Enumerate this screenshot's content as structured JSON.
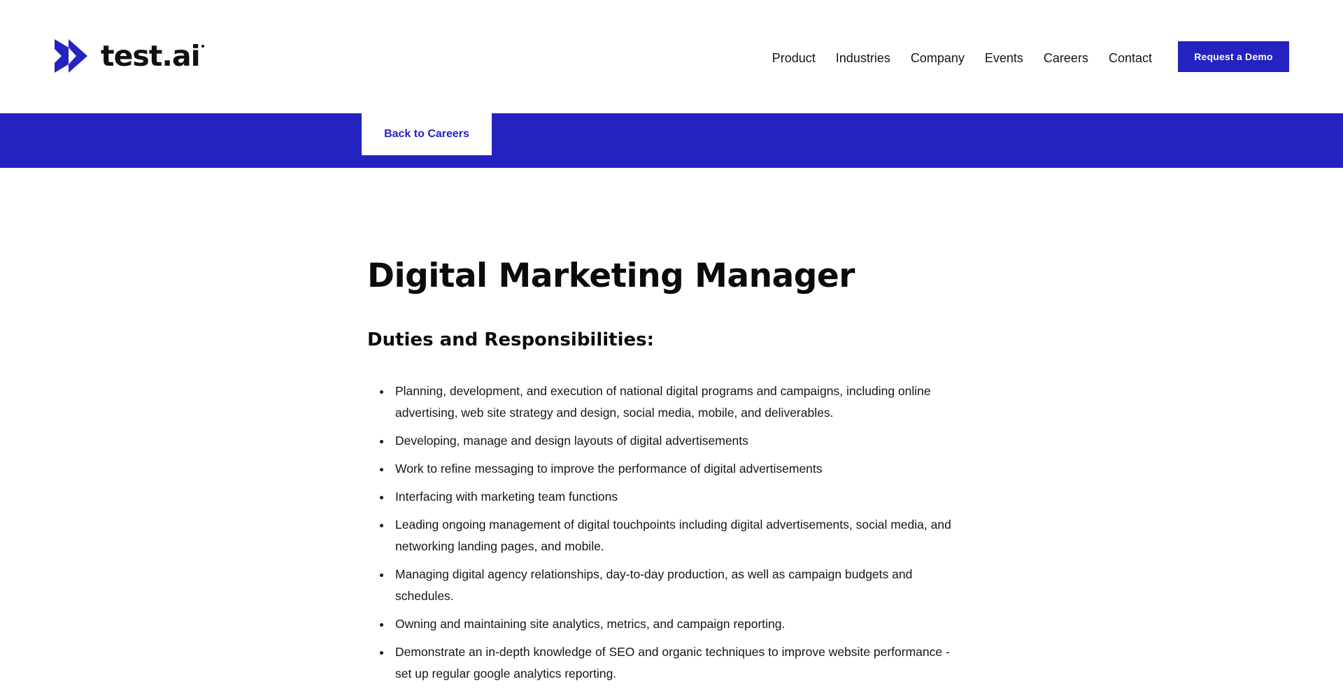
{
  "header": {
    "brand": "test.ai",
    "nav": [
      {
        "label": "Product"
      },
      {
        "label": "Industries"
      },
      {
        "label": "Company"
      },
      {
        "label": "Events"
      },
      {
        "label": "Careers"
      },
      {
        "label": "Contact"
      }
    ],
    "cta_label": "Request a Demo"
  },
  "banner": {
    "back_label": "Back to Careers"
  },
  "job": {
    "title": "Digital Marketing Manager",
    "section_heading": "Duties and Responsibilities:",
    "duties": [
      "Planning, development, and execution of national digital programs and campaigns, including online advertising, web site strategy and design, social media, mobile, and deliverables.",
      "Developing, manage and design layouts of digital advertisements",
      "Work to refine messaging to improve the performance of digital advertisements",
      "Interfacing with marketing team functions",
      "Leading ongoing management of digital touchpoints including digital advertisements, social media, and networking landing pages, and mobile.",
      "Managing digital agency relationships, day-to-day production, as well as campaign budgets and schedules.",
      "Owning and maintaining site analytics, metrics, and campaign reporting.",
      "Demonstrate an in-depth knowledge of SEO and organic techniques to improve website performance - set up regular google analytics reporting."
    ]
  },
  "colors": {
    "brand_blue": "#2523c0",
    "text": "#161616",
    "background": "#ffffff"
  },
  "icons": {
    "logo": "double-chevron-logo-icon"
  }
}
